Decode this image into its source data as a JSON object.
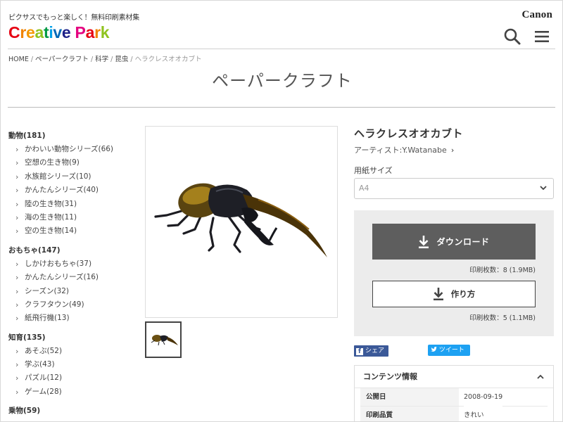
{
  "header": {
    "tagline": "ピクサスでもっと楽しく！無料印刷素材集",
    "logo": [
      "C",
      "r",
      "e",
      "a",
      "t",
      "i",
      "v",
      "e",
      " ",
      "P",
      "a",
      "r",
      "k"
    ],
    "logo_colors": [
      "#e60012",
      "#f08300",
      "#f39800",
      "#8fc31f",
      "#009944",
      "#00a0e9",
      "#0068b7",
      "#1d2088",
      "#ffffff",
      "#e4007f",
      "#e60012",
      "#f08300",
      "#8fc31f"
    ],
    "brand": "Canon",
    "search_icon": "search-icon",
    "menu_icon": "hamburger-menu-icon"
  },
  "breadcrumb": {
    "items": [
      "HOME",
      "ペーパークラフト",
      "科学",
      "昆虫"
    ],
    "current": "ヘラクレスオオカブト",
    "separator": "/"
  },
  "page_title": "ペーパークラフト",
  "sidebar": {
    "groups": [
      {
        "label": "動物(181)",
        "items": [
          "かわいい動物シリーズ(66)",
          "空想の生き物(9)",
          "水族館シリーズ(10)",
          "かんたんシリーズ(40)",
          "陸の生き物(31)",
          "海の生き物(11)",
          "空の生き物(14)"
        ]
      },
      {
        "label": "おもちゃ(147)",
        "items": [
          "しかけおもちゃ(37)",
          "かんたんシリーズ(16)",
          "シーズン(32)",
          "クラフタウン(49)",
          "紙飛行機(13)"
        ]
      },
      {
        "label": "知育(135)",
        "items": [
          "あそぶ(52)",
          "学ぶ(43)",
          "パズル(12)",
          "ゲーム(28)"
        ]
      },
      {
        "label": "乗物(59)",
        "items": []
      }
    ]
  },
  "product": {
    "title": "ヘラクレスオオカブト",
    "artist": "アーティスト:Y.Watanabe",
    "paper_size_label": "用紙サイズ",
    "paper_size_value": "A4",
    "download_label": "ダウンロード",
    "download_meta": "印刷枚数：8 (1.9MB)",
    "howto_label": "作り方",
    "howto_meta": "印刷枚数：5 (1.1MB)"
  },
  "share": {
    "facebook": "シェア",
    "twitter": "ツイート"
  },
  "contents_info": {
    "title": "コンテンツ情報",
    "rows": [
      {
        "key": "公開日",
        "value": "2008-09-19"
      },
      {
        "key": "印刷品質",
        "value": "きれい"
      }
    ]
  },
  "colors": {
    "download_button": "#5e5e5e",
    "panel_bg": "#ececec",
    "facebook": "#3b5998",
    "twitter": "#1da1f2"
  }
}
